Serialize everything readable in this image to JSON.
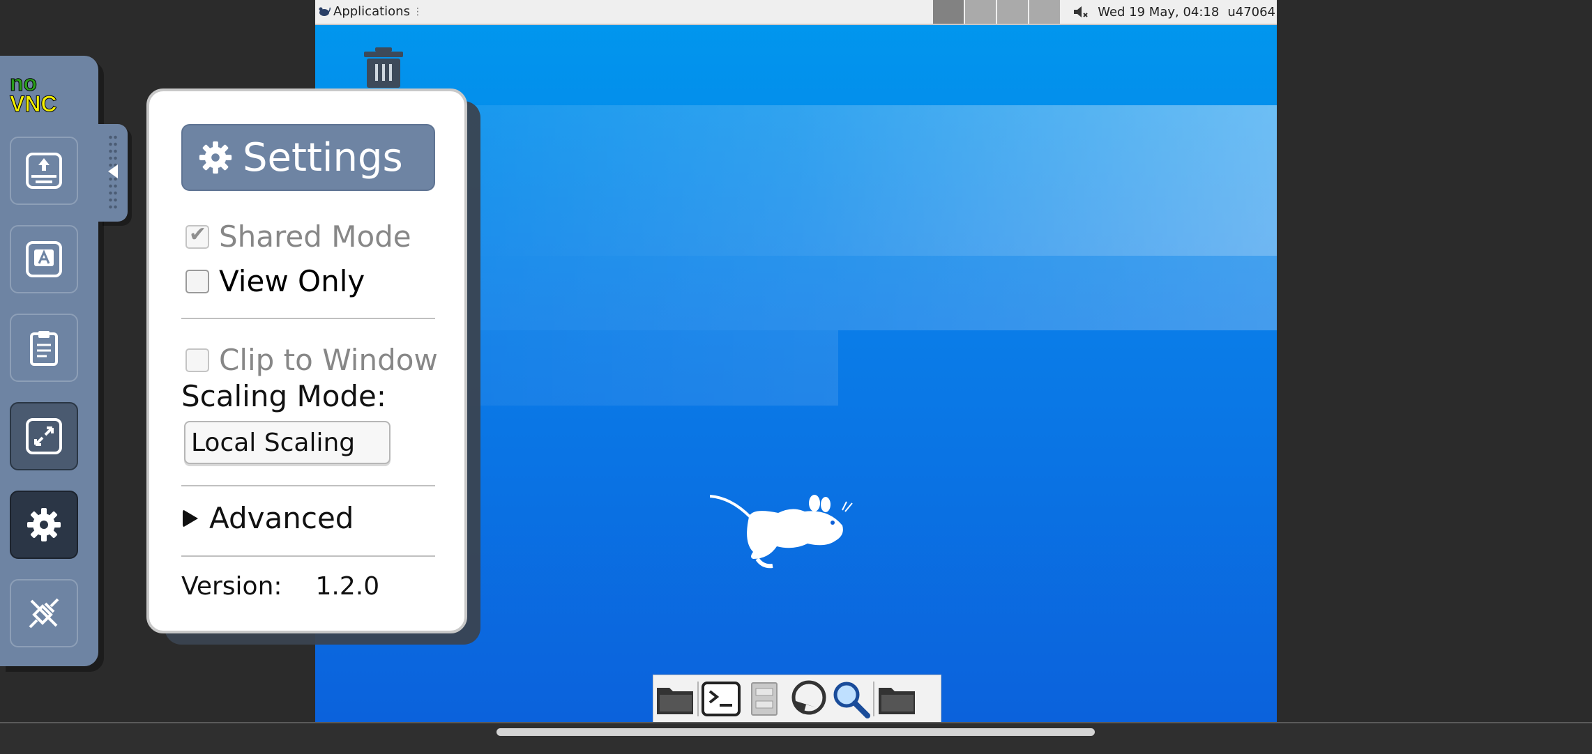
{
  "desktop": {
    "topbar": {
      "applications_label": "Applications",
      "applications_glyph": "⋮",
      "workspaces": [
        "",
        "",
        "",
        ""
      ],
      "volume_icon": "volume-muted-icon",
      "clock": "Wed 19 May, 04:18",
      "user": "u47064"
    },
    "icons": {
      "trash": "trash-icon",
      "mascot": "xfce-mouse-icon"
    },
    "dock": [
      "file-manager-icon",
      "terminal-icon",
      "file-cabinet-icon",
      "web-browser-icon",
      "search-icon",
      "folder-icon"
    ]
  },
  "controlbar": {
    "logo": {
      "line1": "no",
      "line2": "VNC"
    },
    "buttons": [
      {
        "name": "extra-keys-button",
        "icon": "keyboard-up-icon"
      },
      {
        "name": "keyboard-button",
        "icon": "keyboard-a-icon"
      },
      {
        "name": "clipboard-button",
        "icon": "clipboard-icon"
      },
      {
        "name": "fullscreen-button",
        "icon": "fullscreen-icon"
      },
      {
        "name": "settings-button",
        "icon": "gear-icon"
      },
      {
        "name": "disconnect-button",
        "icon": "disconnect-icon"
      }
    ]
  },
  "settings": {
    "title": "Settings",
    "shared_mode": {
      "label": "Shared Mode",
      "checked": true,
      "disabled": true
    },
    "view_only": {
      "label": "View Only",
      "checked": false
    },
    "clip_to_window": {
      "label": "Clip to Window",
      "checked": false,
      "disabled": true
    },
    "scaling_mode_label": "Scaling Mode:",
    "scaling_mode_value": "Local Scaling",
    "advanced_label": "Advanced",
    "version_label": "Version:",
    "version_value": "1.2.0"
  },
  "colors": {
    "control_bar": "#6e84a3",
    "desktop_top": "#0098ee",
    "desktop_bottom": "#0b62dc"
  }
}
